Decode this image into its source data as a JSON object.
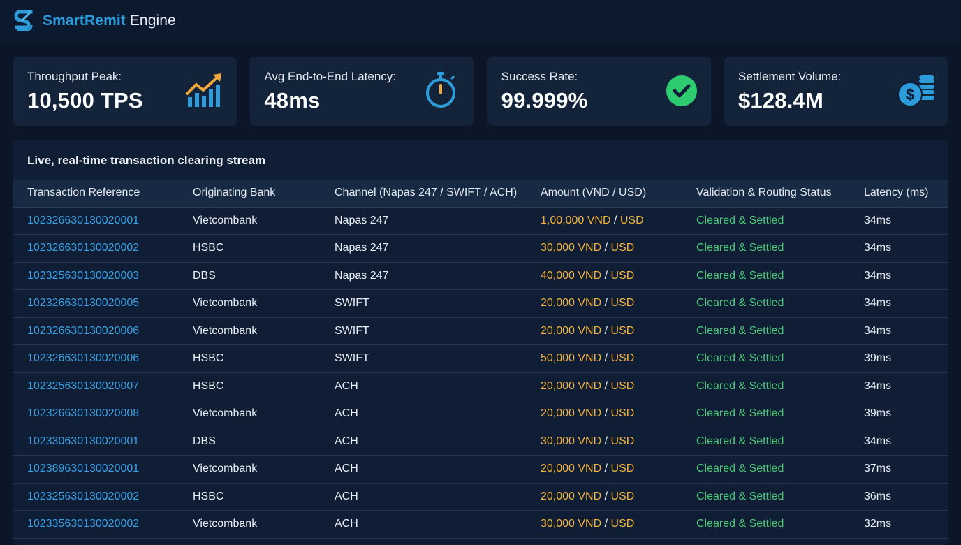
{
  "app": {
    "name_part1": "SmartRemit",
    "name_part2": "Engine"
  },
  "metrics": [
    {
      "label": "Throughput Peak:",
      "value": "10,500 TPS",
      "icon": "chart-trend-icon"
    },
    {
      "label": "Avg End-to-End Latency:",
      "value": "48ms",
      "icon": "stopwatch-icon"
    },
    {
      "label": "Success Rate:",
      "value": "99.999%",
      "icon": "check-circle-icon"
    },
    {
      "label": "Settlement Volume:",
      "value": "$128.4M",
      "icon": "coins-icon"
    }
  ],
  "stream": {
    "title": "Live, real-time transaction clearing stream",
    "columns": [
      "Transaction Reference",
      "Originating Bank",
      "Channel (Napas 247 / SWIFT / ACH)",
      "Amount (VND / USD)",
      "Validation & Routing Status",
      "Latency (ms)"
    ],
    "rows": [
      {
        "ref": "102326630130020001",
        "bank": "Vietcombank",
        "channel": "Napas 247",
        "amount": "1,00,000 VND",
        "currency": "USD",
        "status": "Cleared & Settled",
        "latency": "34ms"
      },
      {
        "ref": "102326630130020002",
        "bank": "HSBC",
        "channel": "Napas 247",
        "amount": "30,000 VND",
        "currency": "USD",
        "status": "Cleared & Settled",
        "latency": "34ms"
      },
      {
        "ref": "102325630130020003",
        "bank": "DBS",
        "channel": "Napas 247",
        "amount": "40,000 VND",
        "currency": "USD",
        "status": "Cleared & Settled",
        "latency": "34ms"
      },
      {
        "ref": "102326630130020005",
        "bank": "Vietcombank",
        "channel": "SWIFT",
        "amount": "20,000 VND",
        "currency": "USD",
        "status": "Cleared & Settled",
        "latency": "34ms"
      },
      {
        "ref": "102326630130020006",
        "bank": "Vietcombank",
        "channel": "SWIFT",
        "amount": "20,000 VND",
        "currency": "USD",
        "status": "Cleared & Settled",
        "latency": "34ms"
      },
      {
        "ref": "102326630130020006",
        "bank": "HSBC",
        "channel": "SWIFT",
        "amount": "50,000 VND",
        "currency": "USD",
        "status": "Cleared & Settled",
        "latency": "39ms"
      },
      {
        "ref": "102325630130020007",
        "bank": "HSBC",
        "channel": "ACH",
        "amount": "20,000 VND",
        "currency": "USD",
        "status": "Cleared & Settled",
        "latency": "34ms"
      },
      {
        "ref": "102326630130020008",
        "bank": "Vietcombank",
        "channel": "ACH",
        "amount": "20,000 VND",
        "currency": "USD",
        "status": "Cleared & Settled",
        "latency": "39ms"
      },
      {
        "ref": "102330630130020001",
        "bank": "DBS",
        "channel": "ACH",
        "amount": "30,000 VND",
        "currency": "USD",
        "status": "Cleared & Settled",
        "latency": "34ms"
      },
      {
        "ref": "102389630130020001",
        "bank": "Vietcombank",
        "channel": "ACH",
        "amount": "20,000 VND",
        "currency": "USD",
        "status": "Cleared & Settled",
        "latency": "37ms"
      },
      {
        "ref": "102325630130020002",
        "bank": "HSBC",
        "channel": "ACH",
        "amount": "20,000 VND",
        "currency": "USD",
        "status": "Cleared & Settled",
        "latency": "36ms"
      },
      {
        "ref": "102335630130020002",
        "bank": "Vietcombank",
        "channel": "ACH",
        "amount": "30,000 VND",
        "currency": "USD",
        "status": "Cleared & Settled",
        "latency": "32ms"
      }
    ]
  },
  "colors": {
    "accent_blue": "#2d9cdb",
    "amount_orange": "#f2b33d",
    "status_green": "#4cc77a",
    "success_green": "#2ecc71"
  }
}
